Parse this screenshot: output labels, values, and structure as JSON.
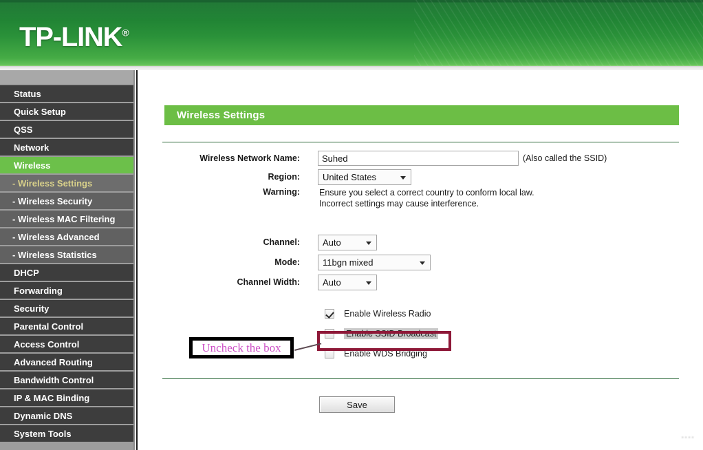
{
  "header": {
    "brand": "TP-LINK",
    "registered_mark": "®"
  },
  "sidebar": {
    "items": [
      {
        "label": "Status",
        "type": "top",
        "state": "normal"
      },
      {
        "label": "Quick Setup",
        "type": "top",
        "state": "normal"
      },
      {
        "label": "QSS",
        "type": "top",
        "state": "normal"
      },
      {
        "label": "Network",
        "type": "top",
        "state": "normal"
      },
      {
        "label": "Wireless",
        "type": "top",
        "state": "active"
      },
      {
        "label": "- Wireless Settings",
        "type": "sub",
        "state": "active"
      },
      {
        "label": "- Wireless Security",
        "type": "sub",
        "state": "normal"
      },
      {
        "label": "- Wireless MAC Filtering",
        "type": "sub",
        "state": "normal"
      },
      {
        "label": "- Wireless Advanced",
        "type": "sub",
        "state": "normal"
      },
      {
        "label": "- Wireless Statistics",
        "type": "sub",
        "state": "normal"
      },
      {
        "label": "DHCP",
        "type": "top",
        "state": "normal"
      },
      {
        "label": "Forwarding",
        "type": "top",
        "state": "normal"
      },
      {
        "label": "Security",
        "type": "top",
        "state": "normal"
      },
      {
        "label": "Parental Control",
        "type": "top",
        "state": "normal"
      },
      {
        "label": "Access Control",
        "type": "top",
        "state": "normal"
      },
      {
        "label": "Advanced Routing",
        "type": "top",
        "state": "normal"
      },
      {
        "label": "Bandwidth Control",
        "type": "top",
        "state": "normal"
      },
      {
        "label": "IP & MAC Binding",
        "type": "top",
        "state": "normal"
      },
      {
        "label": "Dynamic DNS",
        "type": "top",
        "state": "normal"
      },
      {
        "label": "System Tools",
        "type": "top",
        "state": "normal"
      }
    ]
  },
  "main": {
    "title": "Wireless Settings",
    "fields": {
      "ssid_label": "Wireless Network Name:",
      "ssid_value": "Suhed",
      "ssid_hint": "(Also called the SSID)",
      "region_label": "Region:",
      "region_value": "United States",
      "warning_label": "Warning:",
      "warning_line1": "Ensure you select a correct country to conform local law.",
      "warning_line2": "Incorrect settings may cause interference.",
      "channel_label": "Channel:",
      "channel_value": "Auto",
      "mode_label": "Mode:",
      "mode_value": "11bgn mixed",
      "channel_width_label": "Channel Width:",
      "channel_width_value": "Auto"
    },
    "checkboxes": [
      {
        "label": "Enable Wireless Radio",
        "checked": true,
        "highlighted": false
      },
      {
        "label": "Enable SSID Broadcast",
        "checked": false,
        "highlighted": true
      },
      {
        "label": "Enable WDS Bridging",
        "checked": false,
        "highlighted": false
      }
    ],
    "save_label": "Save"
  },
  "annotation": {
    "callout_text": "Uncheck the box",
    "callout_border_color": "#000000",
    "callout_text_color": "#cc4fc6",
    "highlight_border_color": "#8e1838"
  },
  "watermark": {
    "text": "▪▪▪▪"
  },
  "colors": {
    "header_green_dark": "#0c5a23",
    "header_green_light": "#63c158",
    "title_bar_green": "#6cbe45",
    "nav_top_bg": "#3d3d3d",
    "nav_sub_bg": "#616161",
    "nav_active_green": "#6cc04a",
    "nav_active_sub_text": "#d8d08a",
    "rule_green": "#2f6b3c"
  }
}
